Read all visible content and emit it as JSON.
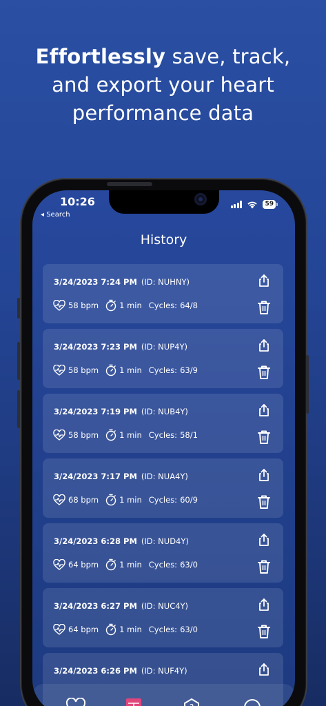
{
  "headline": {
    "bold": "Effortlessly",
    "line1_rest": " save, track,",
    "line2": "and export your heart",
    "line3": "performance data"
  },
  "status_bar": {
    "time": "10:26",
    "back_label": "◂ Search",
    "battery": "59"
  },
  "screen": {
    "title": "History"
  },
  "labels": {
    "cycles": "Cycles:"
  },
  "history": [
    {
      "date": "3/24/2023 7:24 PM",
      "id": "(ID: NUHNY)",
      "bpm": "58 bpm",
      "duration": "1 min",
      "cycles": "64/8"
    },
    {
      "date": "3/24/2023 7:23 PM",
      "id": "(ID: NUP4Y)",
      "bpm": "58 bpm",
      "duration": "1 min",
      "cycles": "63/9"
    },
    {
      "date": "3/24/2023 7:19 PM",
      "id": "(ID: NUB4Y)",
      "bpm": "58 bpm",
      "duration": "1 min",
      "cycles": "58/1"
    },
    {
      "date": "3/24/2023 7:17 PM",
      "id": "(ID: NUA4Y)",
      "bpm": "68 bpm",
      "duration": "1 min",
      "cycles": "60/9"
    },
    {
      "date": "3/24/2023 6:28 PM",
      "id": "(ID: NUD4Y)",
      "bpm": "64 bpm",
      "duration": "1 min",
      "cycles": "63/0"
    },
    {
      "date": "3/24/2023 6:27 PM",
      "id": "(ID: NUC4Y)",
      "bpm": "64 bpm",
      "duration": "1 min",
      "cycles": "63/0"
    },
    {
      "date": "3/24/2023 6:26 PM",
      "id": "(ID: NUF4Y)",
      "bpm": "",
      "duration": "",
      "cycles": ""
    }
  ],
  "tabs": [
    {
      "icon": "heart-icon"
    },
    {
      "icon": "history-icon",
      "active": true
    },
    {
      "icon": "help-icon"
    },
    {
      "icon": "more-icon"
    }
  ],
  "colors": {
    "background": "#2a4fa3",
    "screen": "#22418f",
    "card": "rgba(255,255,255,0.11)",
    "accent_tab": "#e0457b"
  }
}
